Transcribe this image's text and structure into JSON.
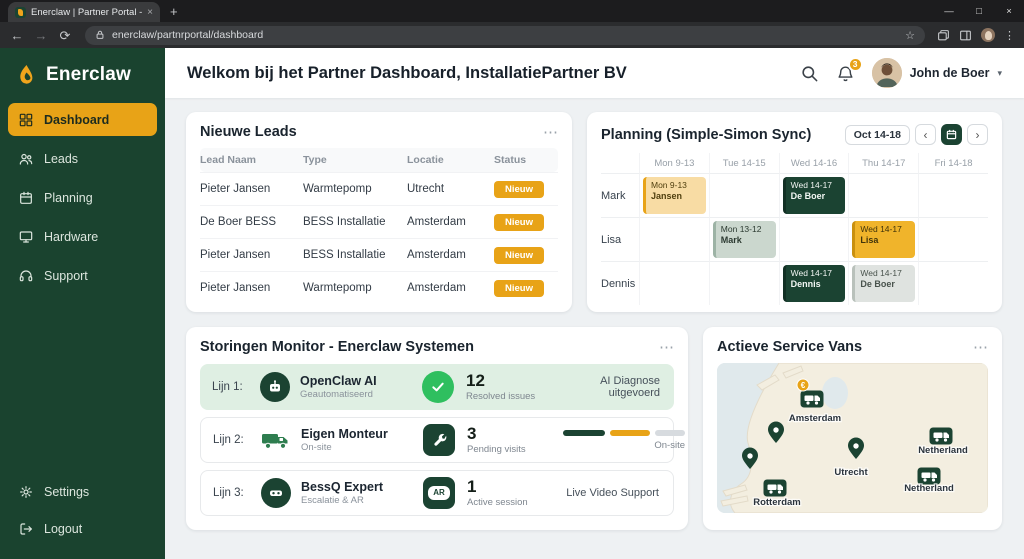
{
  "browser": {
    "tab_title": "Enerclaw | Partner Portal - Da",
    "url": "enerclaw/partnrportal/dashboard"
  },
  "ui": {
    "new_tab": "+",
    "minimize": "—",
    "maximize": "□",
    "close": "×",
    "tab_close": "×",
    "back": "←",
    "forward": "→",
    "reload": "⟳",
    "bookmark_star": "☆",
    "menu_dots": "⋮",
    "more": "⋯",
    "prev": "‹",
    "next": "›",
    "chevron_down": "▾"
  },
  "sidebar": {
    "brand": "Enerclaw",
    "items": [
      {
        "label": "Dashboard"
      },
      {
        "label": "Leads"
      },
      {
        "label": "Planning"
      },
      {
        "label": "Hardware"
      },
      {
        "label": "Support"
      }
    ],
    "footer": [
      {
        "label": "Settings"
      },
      {
        "label": "Logout"
      }
    ]
  },
  "header": {
    "title": "Welkom bij het Partner Dashboard, InstallatiePartner BV",
    "notifications": "3",
    "user": "John de Boer"
  },
  "leads": {
    "title": "Nieuwe Leads",
    "columns": [
      "Lead Naam",
      "Type",
      "Locatie",
      "Status"
    ],
    "rows": [
      {
        "name": "Pieter Jansen",
        "type": "Warmtepomp",
        "loc": "Utrecht",
        "status": "Nieuw"
      },
      {
        "name": "De Boer BESS",
        "type": "BESS Installatie",
        "loc": "Amsterdam",
        "status": "Nieuw"
      },
      {
        "name": "Pieter Jansen",
        "type": "BESS Installatie",
        "loc": "Amsterdam",
        "status": "Nieuw"
      },
      {
        "name": "Pieter Jansen",
        "type": "Warmtepomp",
        "loc": "Amsterdam",
        "status": "Nieuw"
      }
    ]
  },
  "planning": {
    "title": "Planning (Simple-Simon Sync)",
    "range": "Oct 14-18",
    "days": [
      "Mon 9-13",
      "Tue 14-15",
      "Wed 14-16",
      "Thu 14-17",
      "Fri 14-18"
    ],
    "staff": [
      "Mark",
      "Lisa",
      "Dennis"
    ],
    "events": {
      "mark_mon": {
        "time": "Mon 9-13",
        "person": "Jansen"
      },
      "mark_wed": {
        "time": "Wed 14-17",
        "person": "De Boer"
      },
      "lisa_tue": {
        "time": "Mon 13-12",
        "person": "Mark"
      },
      "lisa_thu": {
        "time": "Wed 14-17",
        "person": "Lisa"
      },
      "dennis_wed": {
        "time": "Wed 14-17",
        "person": "Dennis"
      },
      "dennis_thu": {
        "time": "Wed 14-17",
        "person": "De Boer"
      }
    }
  },
  "monitor": {
    "title": "Storingen Monitor - Enerclaw Systemen",
    "ar_badge": "AR",
    "rows": [
      {
        "line": "Lijn 1:",
        "name": "OpenClaw AI",
        "sub": "Geautomatiseerd",
        "count": "12",
        "count_label": "Resolved issues",
        "note": "AI Diagnose uitgevoerd"
      },
      {
        "line": "Lijn 2:",
        "name": "Eigen Monteur",
        "sub": "On-site",
        "count": "3",
        "count_label": "Pending visits",
        "note": "On-site"
      },
      {
        "line": "Lijn 3:",
        "name": "BessQ Expert",
        "sub": "Escalatie & AR",
        "count": "1",
        "count_label": "Active session",
        "note": "Live Video Support"
      }
    ]
  },
  "vans": {
    "title": "Actieve Service Vans",
    "euro": "€",
    "labels": {
      "amsterdam": "Amsterdam",
      "utrecht": "Utrecht",
      "rotterdam": "Rotterdam",
      "netherland_1": "Netherland",
      "netherland_2": "Netherland"
    }
  },
  "colors": {
    "green_dark": "#1B4332",
    "amber": "#E8A317",
    "success": "#2FBF5F"
  }
}
